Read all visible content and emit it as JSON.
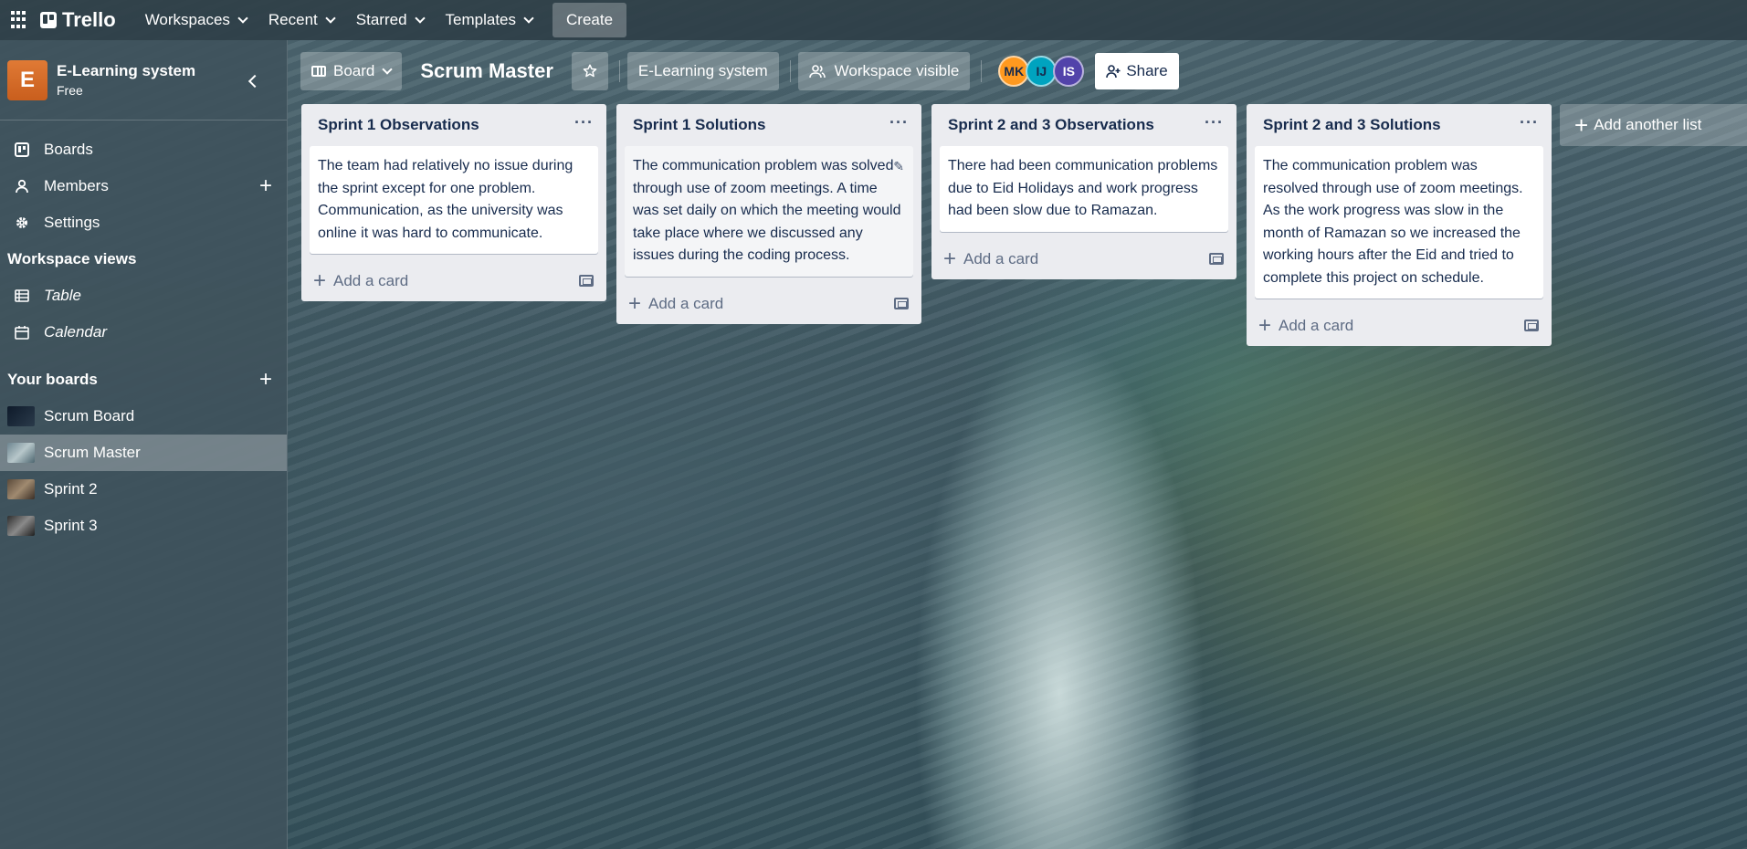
{
  "topbar": {
    "logo": "Trello",
    "nav": [
      "Workspaces",
      "Recent",
      "Starred",
      "Templates"
    ],
    "create": "Create"
  },
  "sidebar": {
    "workspace_initial": "E",
    "workspace_name": "E-Learning system",
    "workspace_plan": "Free",
    "items": [
      {
        "label": "Boards",
        "icon": "board-icon"
      },
      {
        "label": "Members",
        "icon": "person-icon"
      },
      {
        "label": "Settings",
        "icon": "gear-icon"
      }
    ],
    "views_heading": "Workspace views",
    "views": [
      {
        "label": "Table",
        "icon": "table-icon"
      },
      {
        "label": "Calendar",
        "icon": "calendar-icon"
      }
    ],
    "boards_heading": "Your boards",
    "boards": [
      {
        "label": "Scrum Board"
      },
      {
        "label": "Scrum Master",
        "active": true
      },
      {
        "label": "Sprint 2"
      },
      {
        "label": "Sprint 3"
      }
    ]
  },
  "board": {
    "view_label": "Board",
    "title": "Scrum Master",
    "workspace_label": "E-Learning system",
    "visibility_label": "Workspace visible",
    "members": [
      "MK",
      "IJ",
      "IS"
    ],
    "share_label": "Share",
    "add_list_label": "Add another list",
    "add_card_label": "Add a card"
  },
  "lists": [
    {
      "title": "Sprint 1 Observations",
      "cards": [
        "The team had relatively no issue during the sprint except for one problem. Communication, as the university was online it was hard to communicate."
      ]
    },
    {
      "title": "Sprint 1 Solutions",
      "cards": [
        "The communication problem was solved through use of zoom meetings. A time was set daily on which the meeting would take place where we discussed any issues during the coding process."
      ]
    },
    {
      "title": "Sprint 2 and 3 Observations",
      "cards": [
        "There had been communication problems due to Eid Holidays and work progress had been slow due to Ramazan."
      ]
    },
    {
      "title": "Sprint 2 and 3 Solutions",
      "cards": [
        "The communication problem was resolved through use of zoom meetings. As the work progress was slow in the month of Ramazan so we increased the working hours after the Eid and tried to complete this project on schedule."
      ]
    }
  ]
}
